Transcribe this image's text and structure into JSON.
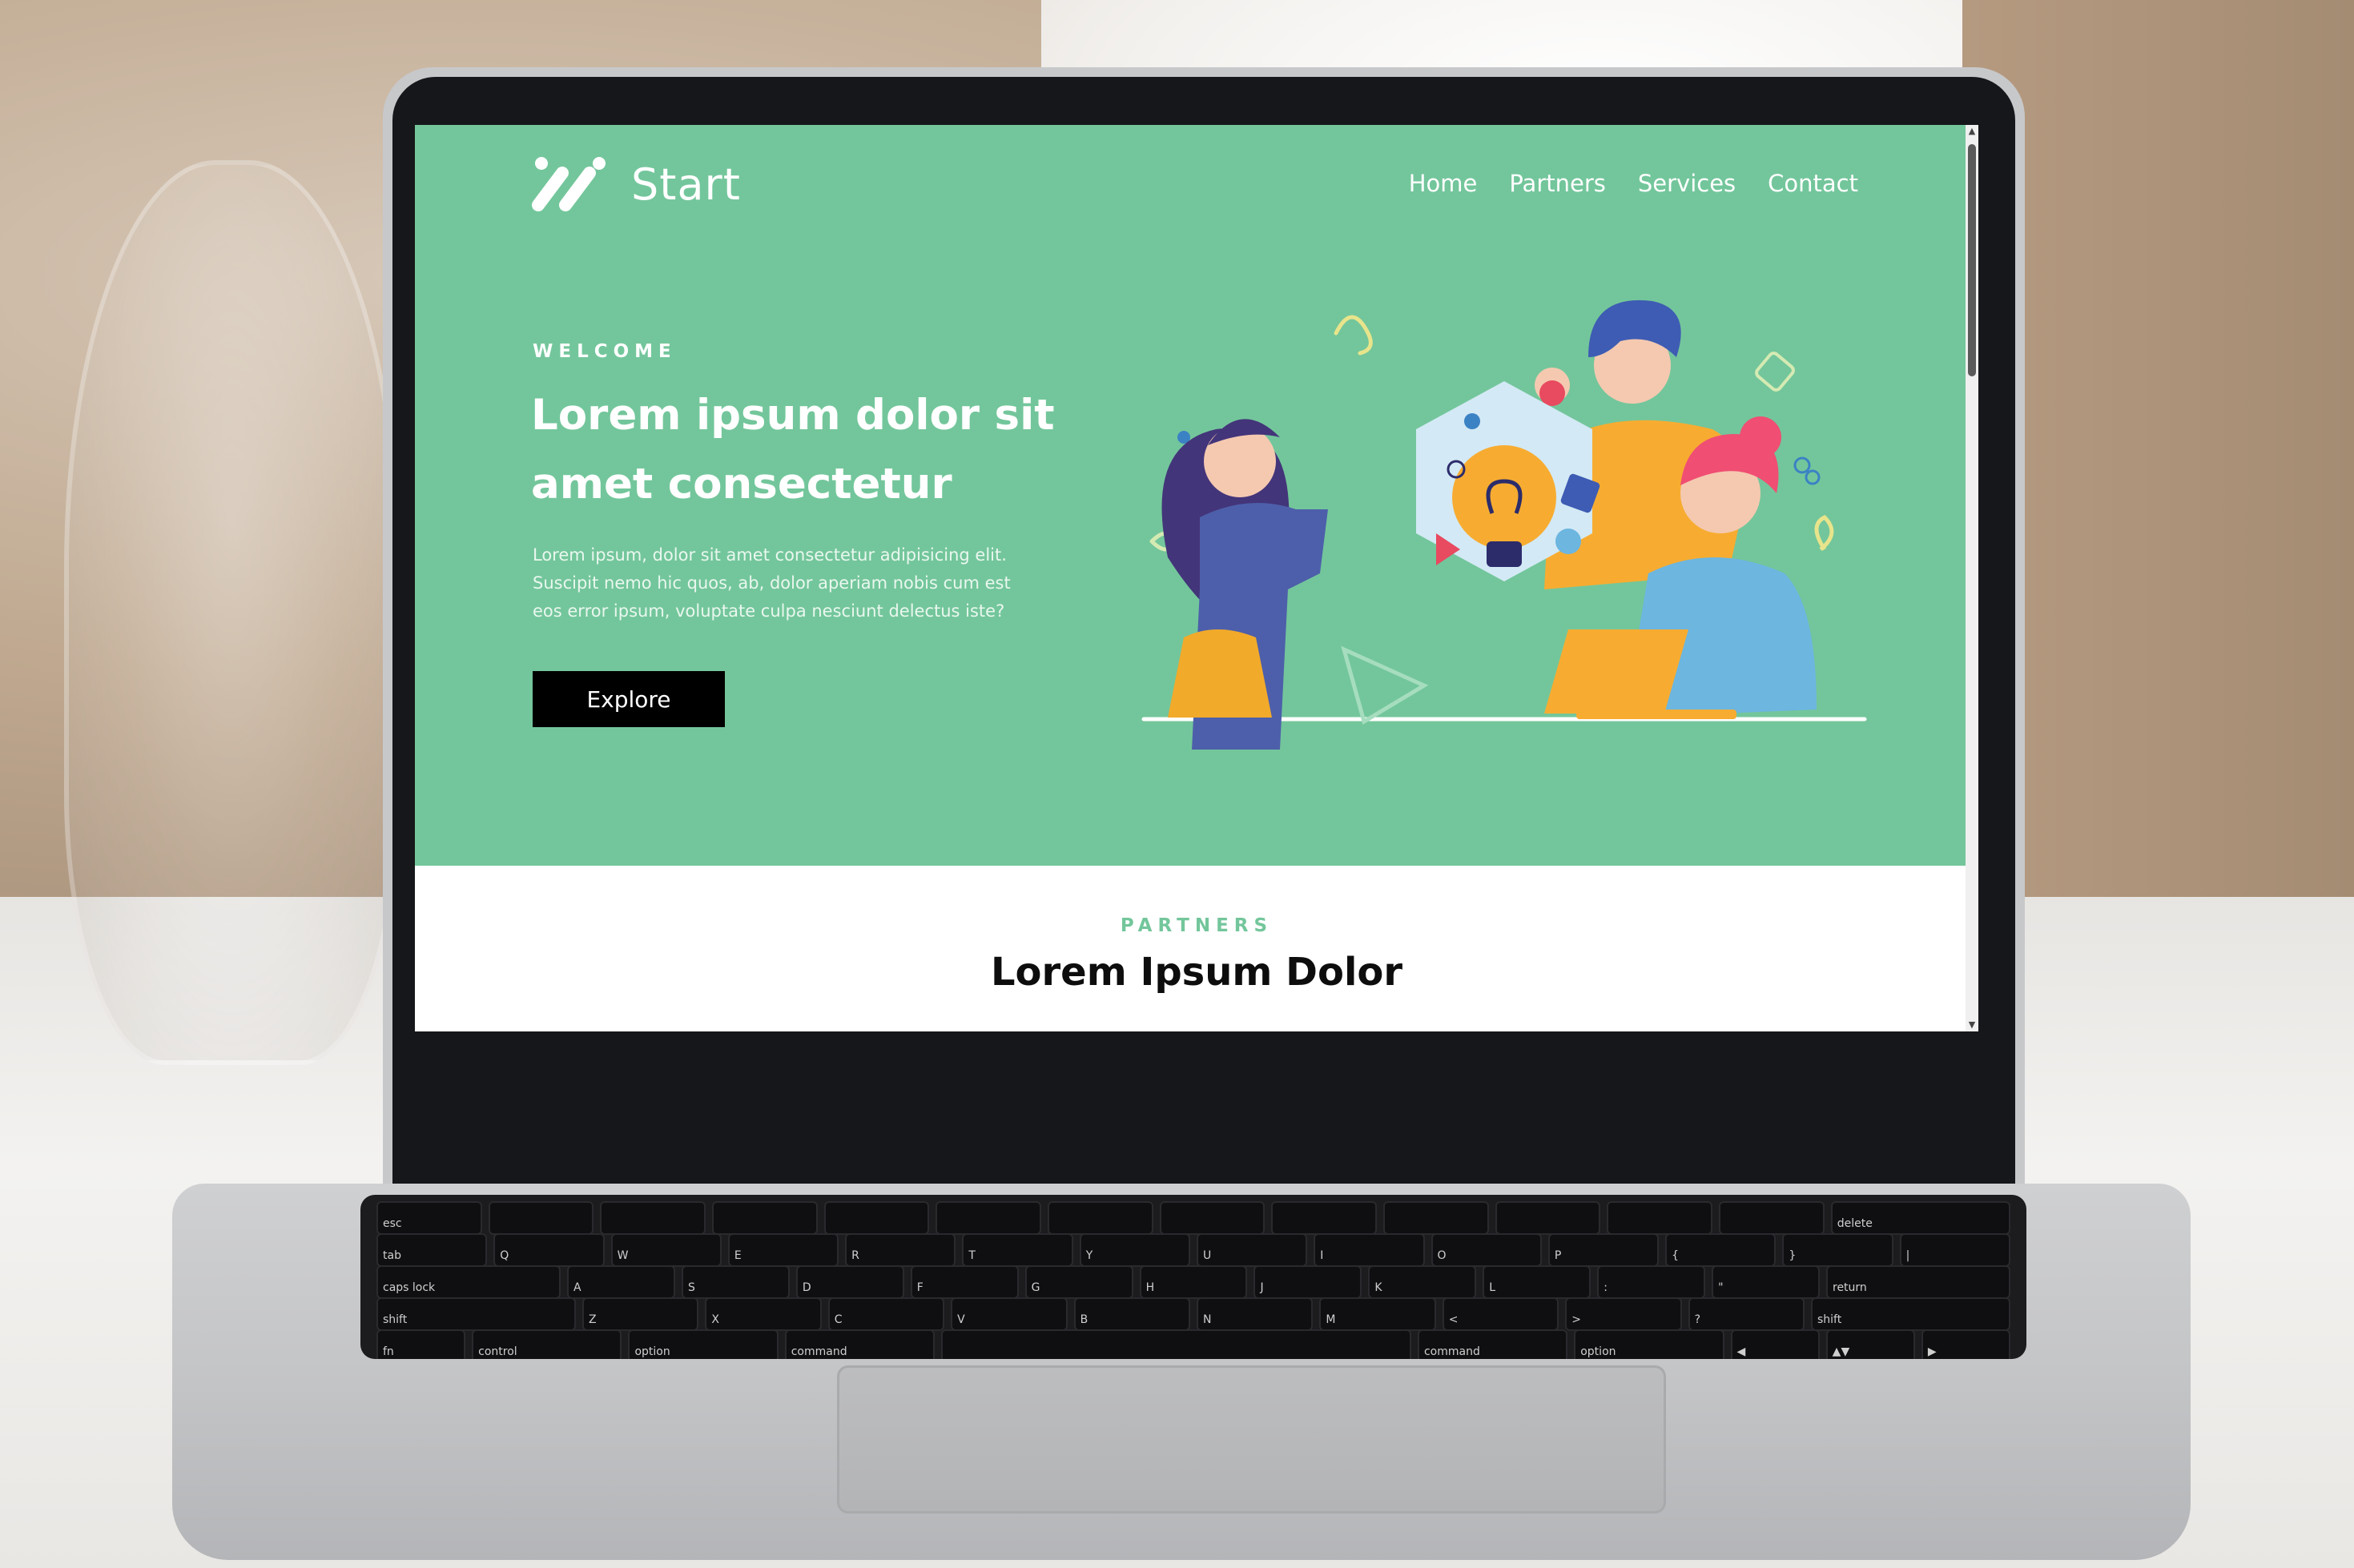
{
  "site": {
    "brand": "Start",
    "logo_icon": "start-logo-icon",
    "nav": [
      {
        "label": "Home"
      },
      {
        "label": "Partners"
      },
      {
        "label": "Services"
      },
      {
        "label": "Contact"
      }
    ]
  },
  "hero": {
    "eyebrow": "WELCOME",
    "headline": "Lorem ipsum dolor sit amet consectetur",
    "body": "Lorem ipsum, dolor sit amet consectetur adipisicing elit. Suscipit nemo hic quos, ab, dolor aperiam nobis cum est eos error ipsum, voluptate culpa nesciunt delectus iste?",
    "cta_label": "Explore",
    "illustration": "team-brainstorm-lightbulb-illustration"
  },
  "partners": {
    "eyebrow": "PARTNERS",
    "title": "Lorem Ipsum Dolor"
  },
  "keyboard": {
    "rows": [
      [
        "esc",
        "",
        "",
        "",
        "",
        "",
        "",
        "",
        "",
        "",
        "",
        "",
        "",
        "delete"
      ],
      [
        "tab",
        "Q",
        "W",
        "E",
        "R",
        "T",
        "Y",
        "U",
        "I",
        "O",
        "P",
        "{",
        "}",
        "|"
      ],
      [
        "caps lock",
        "A",
        "S",
        "D",
        "F",
        "G",
        "H",
        "J",
        "K",
        "L",
        ":",
        "\"",
        "return"
      ],
      [
        "shift",
        "Z",
        "X",
        "C",
        "V",
        "B",
        "N",
        "M",
        "<",
        ">",
        "?",
        "shift"
      ],
      [
        "fn",
        "control",
        "option",
        "command",
        "",
        "command",
        "option",
        "◀",
        "▲▼",
        "▶"
      ]
    ]
  },
  "colors": {
    "hero_bg": "#73c69b",
    "accent": "#73c69b",
    "button_bg": "#000000",
    "text_light": "#ffffff"
  }
}
